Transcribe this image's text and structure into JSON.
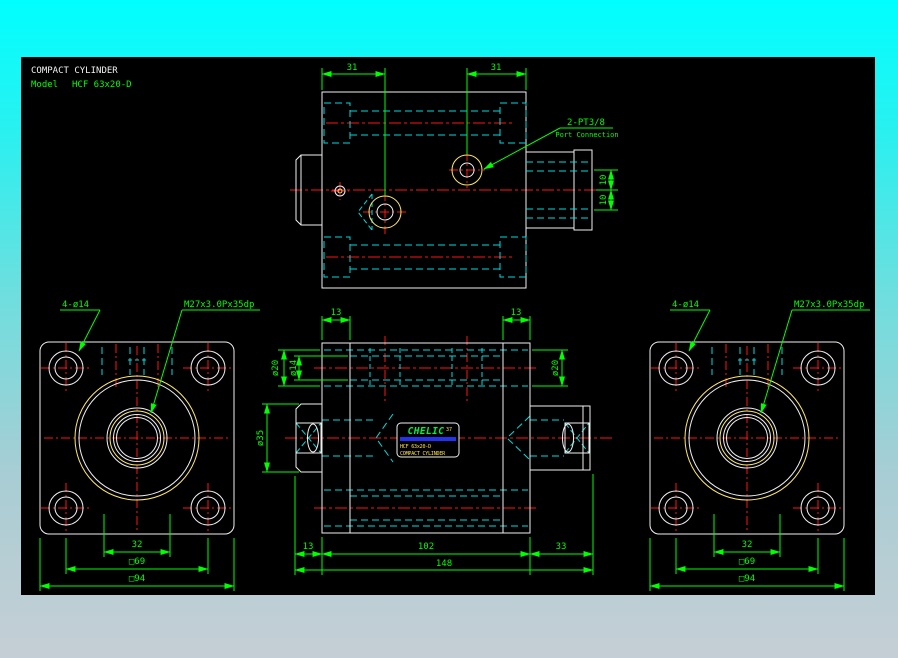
{
  "titleblock": {
    "title": "COMPACT CYLINDER",
    "model_label": "Model",
    "model": "HCF 63x20-D"
  },
  "top_view": {
    "dim_left": "31",
    "dim_right": "31",
    "port_callout": "2-PT3/8",
    "port_callout_sub": "Port Connection",
    "dim_offset_upper": "10",
    "dim_offset_lower": "10"
  },
  "front_left": {
    "holes": "4-ø14",
    "thread": "M27x3.0Px35dp",
    "dim_inner": "32",
    "dim_bolt_square": "□69",
    "dim_outer_square": "□94"
  },
  "front_right": {
    "holes": "4-ø14",
    "thread": "M27x3.0Px35dp",
    "dim_inner": "32",
    "dim_bolt_square": "□69",
    "dim_outer_square": "□94"
  },
  "side_view": {
    "dim_cb_left": "13",
    "dim_cb_right": "13",
    "dim_counterbore_left": "ø20",
    "dim_through_hole": "ø14",
    "dim_counterbore_right": "ø20",
    "dim_rod_flat": "ø35",
    "dim_rod_ext": "13",
    "dim_body": "102",
    "dim_head": "33",
    "dim_total": "148",
    "nameplate": {
      "brand": "CHELIC",
      "mark": "37",
      "model": "HCF 63x20-D",
      "name": "COMPACT CYLINDER"
    }
  },
  "colors": {
    "background_top": "#00ffff",
    "background_bottom": "#c6ced5",
    "canvas": "#000000",
    "outline": "#f0f0f0",
    "hidden_line": "#00dcdc",
    "centerline": "#ff1515",
    "dimension": "#00ff00",
    "highlight": "#ffe96a",
    "nameplate_stripe": "#2233ee"
  }
}
